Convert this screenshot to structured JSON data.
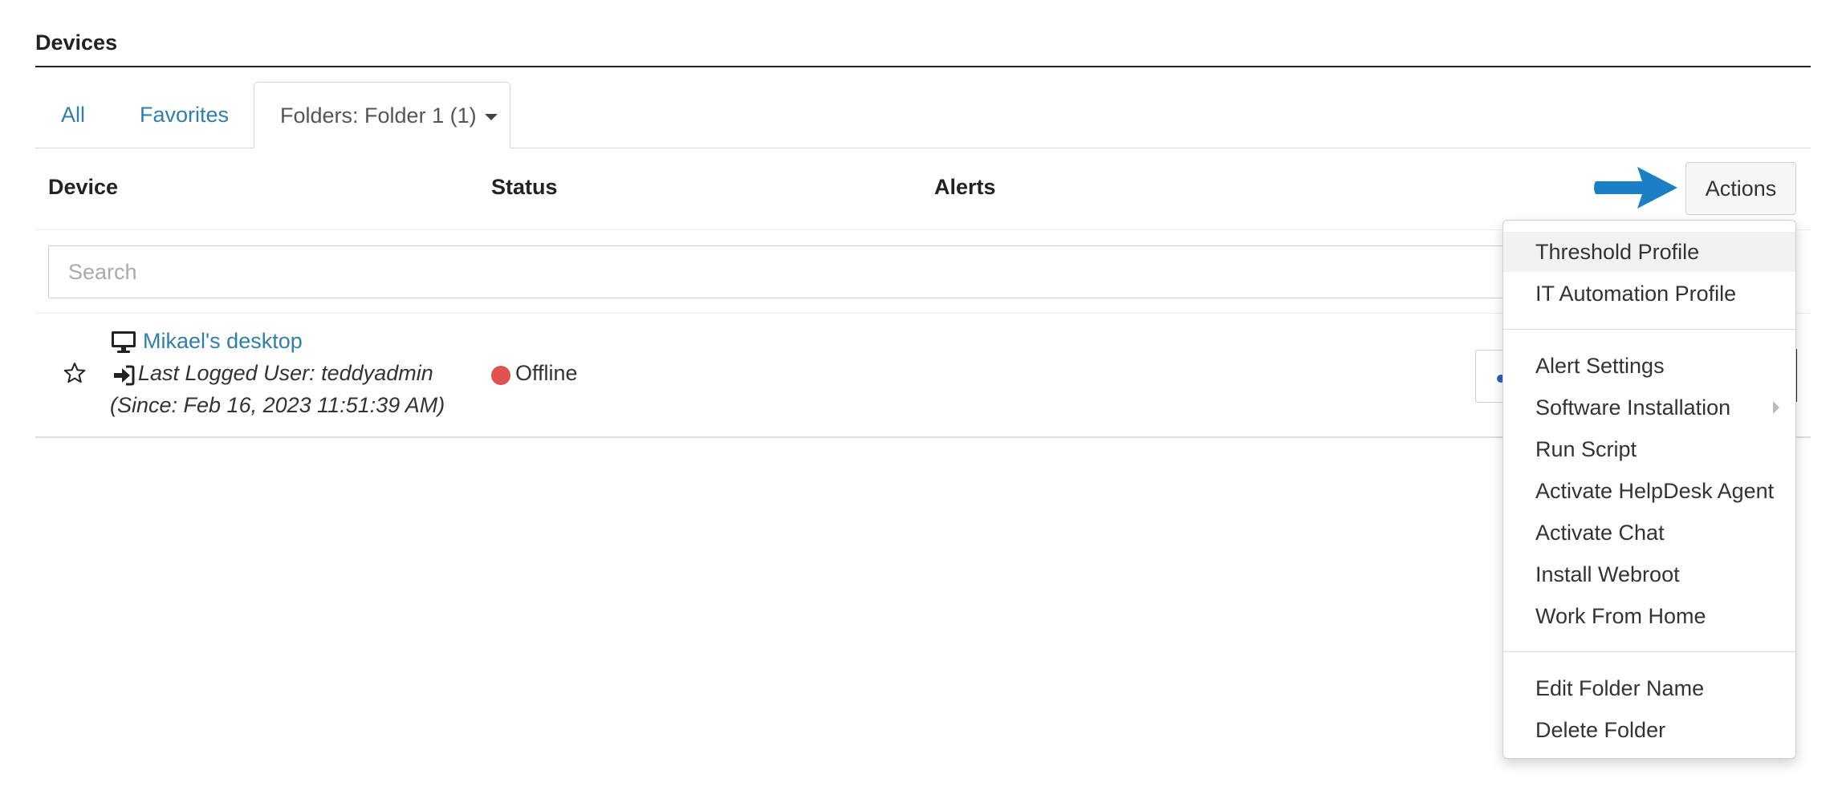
{
  "section": {
    "title": "Devices"
  },
  "tabs": {
    "all": "All",
    "favorites": "Favorites",
    "folder": "Folders: Folder 1 (1)"
  },
  "table": {
    "headers": {
      "device": "Device",
      "status": "Status",
      "alerts": "Alerts"
    },
    "actions_label": "Actions"
  },
  "search": {
    "placeholder": "Search",
    "value": ""
  },
  "devices": [
    {
      "name": "Mikael's desktop",
      "last_user": "Last Logged User: teddyadmin",
      "since": "(Since: Feb 16, 2023 11:51:39 AM)",
      "status": "Offline",
      "status_color": "#e05252"
    }
  ],
  "menu": {
    "items": [
      {
        "label": "Threshold Profile",
        "active": true
      },
      {
        "label": "IT Automation Profile"
      },
      {
        "label": "Alert Settings"
      },
      {
        "label": "Software Installation",
        "has_submenu": true
      },
      {
        "label": "Run Script"
      },
      {
        "label": "Activate HelpDesk Agent"
      },
      {
        "label": "Activate Chat"
      },
      {
        "label": "Install Webroot"
      },
      {
        "label": "Work From Home"
      },
      {
        "label": "Edit Folder Name"
      },
      {
        "label": "Delete Folder"
      }
    ]
  },
  "colors": {
    "link": "#2f7fa8",
    "arrow": "#1a7fc4",
    "offline": "#e05252"
  },
  "icons": [
    "monitor-icon",
    "sign-in-icon",
    "star-icon",
    "caret-down-icon",
    "arrow-right-icon",
    "chevron-right-icon"
  ]
}
